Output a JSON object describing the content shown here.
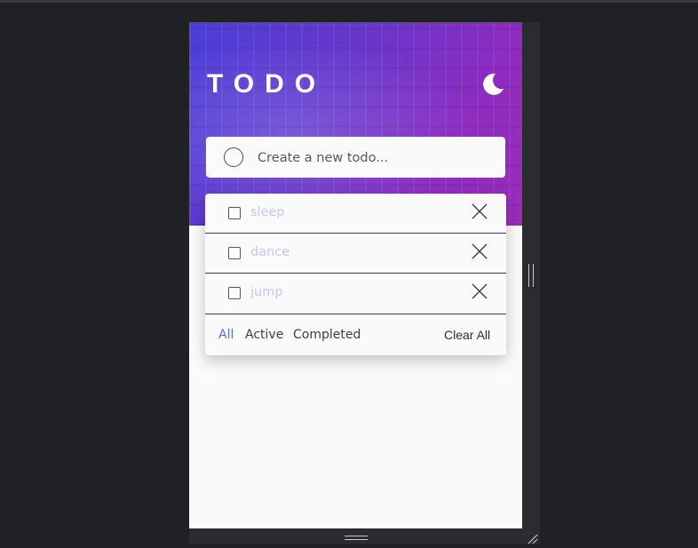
{
  "app": {
    "title": "TODO",
    "theme_toggle_icon": "moon-icon"
  },
  "new_todo": {
    "placeholder": "Create a new todo..."
  },
  "todos": [
    {
      "label": "sleep",
      "completed": false
    },
    {
      "label": "dance",
      "completed": false
    },
    {
      "label": "jump",
      "completed": false
    }
  ],
  "filters": {
    "all": "All",
    "active": "Active",
    "completed": "Completed",
    "selected": "All"
  },
  "clear_label": "Clear All",
  "colors": {
    "accent": "#4a73e0",
    "todo_text": "#c7c6ee",
    "gradient_start": "#4a3fd8",
    "gradient_end": "#9a2db8",
    "app_background": "#fafafa",
    "devtools_background": "#202124"
  }
}
